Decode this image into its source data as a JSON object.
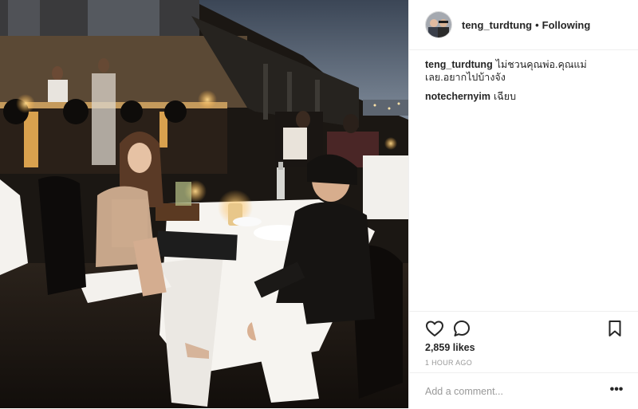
{
  "post": {
    "username": "teng_turdtung",
    "follow_state": "Following",
    "separator": "•",
    "avatar_icon": "profile-avatar"
  },
  "comments": [
    {
      "username": "teng_turdtung",
      "text": "ไม่ชวนคุณพ่อ.คุณแม่เลย.อยากไปบ้างจัง"
    },
    {
      "username": "notechernyim",
      "text": "เฉียบ"
    }
  ],
  "actions": {
    "like_icon": "heart-icon",
    "comment_icon": "speech-bubble-icon",
    "save_icon": "bookmark-icon",
    "likes_text": "2,859 likes",
    "timestamp": "1 HOUR AGO"
  },
  "add_comment": {
    "placeholder": "Add a comment...",
    "more_label": "•••"
  },
  "colors": {
    "text": "#262626",
    "muted": "#999999",
    "border": "#efefef",
    "photo_bg": "#1a1714"
  }
}
